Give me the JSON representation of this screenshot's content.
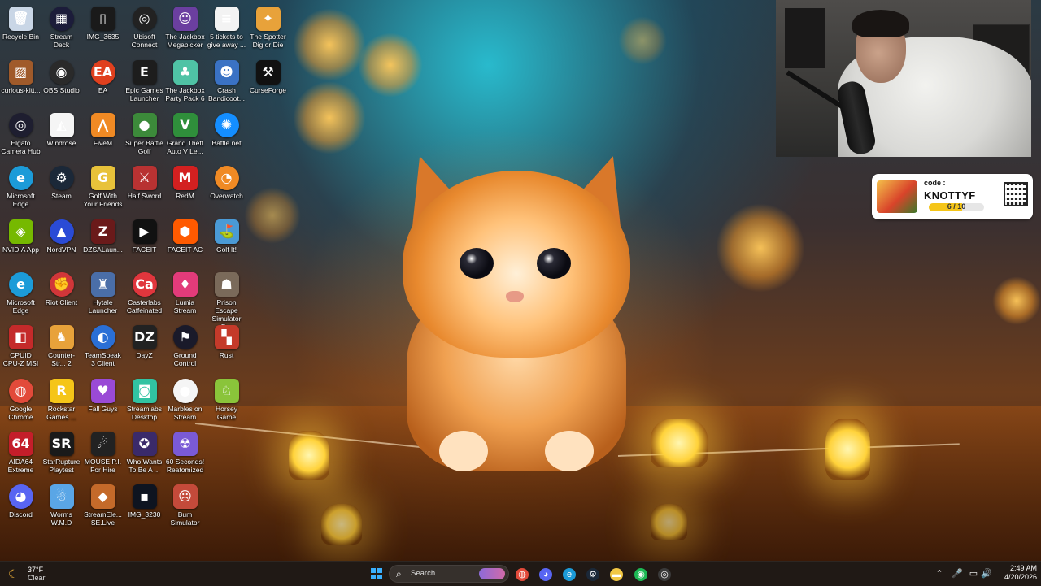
{
  "desktop_icons": [
    {
      "label": "Recycle Bin",
      "glyph": "🗑",
      "color": "#c9d6e6",
      "round": false
    },
    {
      "label": "Stream Deck",
      "glyph": "▦",
      "color": "#1c1c3a",
      "round": true
    },
    {
      "label": "IMG_3635",
      "glyph": "▯",
      "color": "#1a1a1a",
      "round": false
    },
    {
      "label": "Ubisoft Connect",
      "glyph": "◎",
      "color": "#222",
      "round": true
    },
    {
      "label": "The Jackbox Megapicker",
      "glyph": "☺",
      "color": "#6b3fa0",
      "round": false
    },
    {
      "label": "5 tickets to give away ...",
      "glyph": "≡",
      "color": "#f3f3f3",
      "round": false
    },
    {
      "label": "The Spotter Dig or Die",
      "glyph": "✦",
      "color": "#e8a23a",
      "round": false
    },
    {
      "label": "curious-kitt...",
      "glyph": "▨",
      "color": "#a05a2a",
      "round": false
    },
    {
      "label": "OBS Studio",
      "glyph": "◉",
      "color": "#2a2a2a",
      "round": true
    },
    {
      "label": "EA",
      "glyph": "EA",
      "color": "#e0401e",
      "round": true
    },
    {
      "label": "Epic Games Launcher",
      "glyph": "E",
      "color": "#1d1d1d",
      "round": false
    },
    {
      "label": "The Jackbox Party Pack 6",
      "glyph": "♣",
      "color": "#4fc3a5",
      "round": false
    },
    {
      "label": "Crash Bandicoot...",
      "glyph": "☻",
      "color": "#3a72c4",
      "round": false
    },
    {
      "label": "CurseForge",
      "glyph": "⚒",
      "color": "#111",
      "round": false
    },
    {
      "label": "Elgato Camera Hub",
      "glyph": "◎",
      "color": "#1e1e30",
      "round": true
    },
    {
      "label": "Windrose",
      "glyph": "◭",
      "color": "#f5f5f5",
      "round": false
    },
    {
      "label": "FiveM",
      "glyph": "⋀",
      "color": "#f08a24",
      "round": false
    },
    {
      "label": "Super Battle Golf",
      "glyph": "●",
      "color": "#3c8a3a",
      "round": false
    },
    {
      "label": "Grand Theft Auto V Le...",
      "glyph": "V",
      "color": "#2f8f3b",
      "round": false
    },
    {
      "label": "Battle.net",
      "glyph": "✺",
      "color": "#148eff",
      "round": true
    },
    {
      "label": "Microsoft Edge",
      "glyph": "e",
      "color": "#1c9bd8",
      "round": true
    },
    {
      "label": "Steam",
      "glyph": "⚙",
      "color": "#1b2838",
      "round": true
    },
    {
      "label": "Golf With Your Friends",
      "glyph": "G",
      "color": "#e8c23a",
      "round": false
    },
    {
      "label": "Half Sword",
      "glyph": "⚔",
      "color": "#b83232",
      "round": false
    },
    {
      "label": "RedM",
      "glyph": "M",
      "color": "#d32020",
      "round": false
    },
    {
      "label": "Overwatch",
      "glyph": "◔",
      "color": "#f08a24",
      "round": true
    },
    {
      "label": "NVIDIA App",
      "glyph": "◈",
      "color": "#76b900",
      "round": false
    },
    {
      "label": "NordVPN",
      "glyph": "▲",
      "color": "#2a4bd6",
      "round": true
    },
    {
      "label": "DZSALaun...",
      "glyph": "Z",
      "color": "#6a1a1a",
      "round": false
    },
    {
      "label": "FACEIT",
      "glyph": "▶",
      "color": "#111",
      "round": false
    },
    {
      "label": "FACEIT AC",
      "glyph": "⬢",
      "color": "#ff5a00",
      "round": false
    },
    {
      "label": "Golf It!",
      "glyph": "⛳",
      "color": "#4a9ad6",
      "round": false
    },
    {
      "label": "Microsoft Edge",
      "glyph": "e",
      "color": "#1c9bd8",
      "round": true
    },
    {
      "label": "Riot Client",
      "glyph": "✊",
      "color": "#d13639",
      "round": true
    },
    {
      "label": "Hytale Launcher",
      "glyph": "♜",
      "color": "#4a6ea8",
      "round": false
    },
    {
      "label": "Casterlabs Caffeinated",
      "glyph": "Ca",
      "color": "#e0363d",
      "round": true
    },
    {
      "label": "Lumia Stream",
      "glyph": "♦",
      "color": "#e23b7a",
      "round": false
    },
    {
      "label": "Prison Escape Simulator D...",
      "glyph": "☗",
      "color": "#7a6a5a",
      "round": false
    },
    {
      "label": "CPUID CPU-Z MSI",
      "glyph": "◧",
      "color": "#c42a2a",
      "round": false
    },
    {
      "label": "Counter-Str... 2",
      "glyph": "♞",
      "color": "#e8a23a",
      "round": false
    },
    {
      "label": "TeamSpeak 3 Client",
      "glyph": "◐",
      "color": "#2a6fd6",
      "round": true
    },
    {
      "label": "DayZ",
      "glyph": "DZ",
      "color": "#222",
      "round": false
    },
    {
      "label": "Ground Control",
      "glyph": "⚑",
      "color": "#1a1a2a",
      "round": true
    },
    {
      "label": "Rust",
      "glyph": "▚",
      "color": "#c43a2a",
      "round": false
    },
    {
      "label": "Google Chrome",
      "glyph": "◍",
      "color": "#e24a3a",
      "round": true
    },
    {
      "label": "Rockstar Games ...",
      "glyph": "R",
      "color": "#f5c518",
      "round": false
    },
    {
      "label": "Fall Guys",
      "glyph": "♥",
      "color": "#9a4ad6",
      "round": false
    },
    {
      "label": "Streamlabs Desktop",
      "glyph": "◙",
      "color": "#31c3a2",
      "round": false
    },
    {
      "label": "Marbles on Stream",
      "glyph": "●",
      "color": "#f5f5f5",
      "round": true
    },
    {
      "label": "Horsey Game",
      "glyph": "♘",
      "color": "#8ac43a",
      "round": false
    },
    {
      "label": "AIDA64 Extreme",
      "glyph": "64",
      "color": "#c41e2a",
      "round": false
    },
    {
      "label": "StarRupture Playtest",
      "glyph": "SR",
      "color": "#1a1a1a",
      "round": false
    },
    {
      "label": "MOUSE P.I. For Hire",
      "glyph": "☄",
      "color": "#222",
      "round": false
    },
    {
      "label": "Who Wants To Be A ...",
      "glyph": "✪",
      "color": "#3a2a6a",
      "round": false
    },
    {
      "label": "60 Seconds! Reatomized",
      "glyph": "☢",
      "color": "#7a5ad6",
      "round": false
    },
    {
      "label": "Discord",
      "glyph": "◕",
      "color": "#5865f2",
      "round": true
    },
    {
      "label": "Worms W.M.D",
      "glyph": "☃",
      "color": "#5aa6e6",
      "round": false
    },
    {
      "label": "StreamEle... SE.Live",
      "glyph": "◆",
      "color": "#c46a2a",
      "round": false
    },
    {
      "label": "IMG_3230",
      "glyph": "▪",
      "color": "#0e1420",
      "round": false
    },
    {
      "label": "Bum Simulator",
      "glyph": "☹",
      "color": "#c44a3a",
      "round": false
    }
  ],
  "promo": {
    "code_label": "code :",
    "code_value": "KNOTTYF",
    "progress_text": "6 / 10",
    "progress_fraction": 0.6
  },
  "taskbar": {
    "weather_temp": "37°F",
    "weather_condition": "Clear",
    "search_placeholder": "Search",
    "time": "2:49 AM",
    "date": "4/20/2026",
    "pinned_apps": [
      {
        "name": "google-chrome-taskbar-icon",
        "glyph": "◍",
        "color": "#e24a3a"
      },
      {
        "name": "discord-taskbar-icon",
        "glyph": "◕",
        "color": "#5865f2"
      },
      {
        "name": "microsoft-edge-taskbar-icon",
        "glyph": "e",
        "color": "#1c9bd8"
      },
      {
        "name": "steam-taskbar-icon",
        "glyph": "⚙",
        "color": "#1b2838"
      },
      {
        "name": "file-explorer-taskbar-icon",
        "glyph": "▬",
        "color": "#f2c744"
      },
      {
        "name": "spotify-taskbar-icon",
        "glyph": "◉",
        "color": "#1db954"
      },
      {
        "name": "obs-taskbar-icon",
        "glyph": "◎",
        "color": "#3a3a3a"
      }
    ],
    "tray_icons": [
      "chevron-up-icon",
      "microphone-icon",
      "display-icon",
      "network-icon",
      "volume-icon"
    ]
  }
}
